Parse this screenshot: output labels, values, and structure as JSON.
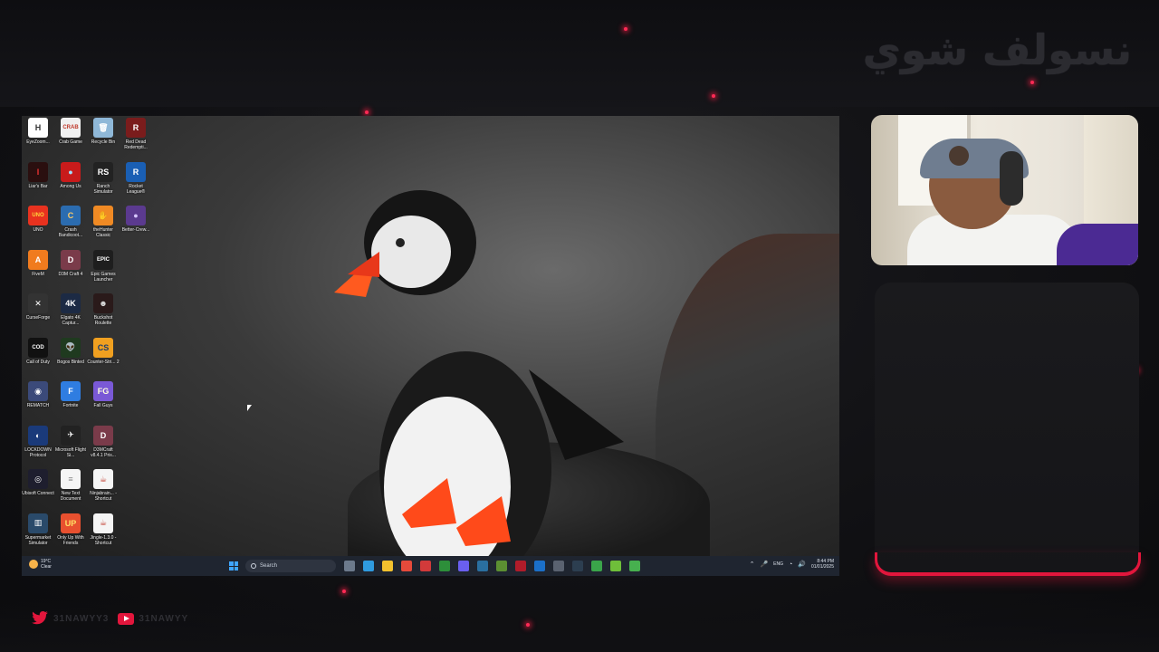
{
  "overlay": {
    "title": "نسولف شوي",
    "accent_color": "#e2163c"
  },
  "desktop": {
    "icons": [
      {
        "label": "EyeZoom...",
        "color": "#ffffff",
        "glyph": "H",
        "glyph_color": "#333"
      },
      {
        "label": "Crab Game",
        "color": "#f0f0f0",
        "glyph": "CRAB",
        "glyph_color": "#c0392b"
      },
      {
        "label": "Recycle Bin",
        "color": "#8fb8d8",
        "glyph": "🗑",
        "glyph_color": "#fff"
      },
      {
        "label": "Red Dead Redempti...",
        "color": "#7a1c1c",
        "glyph": "R",
        "glyph_color": "#fff"
      },
      {
        "label": "Liar's Bar",
        "color": "#2a0f0f",
        "glyph": "I",
        "glyph_color": "#e33"
      },
      {
        "label": "Among Us",
        "color": "#c81b1b",
        "glyph": "●",
        "glyph_color": "#9fe0ff"
      },
      {
        "label": "Ranch Simulator",
        "color": "#222",
        "glyph": "RS",
        "glyph_color": "#fff"
      },
      {
        "label": "Rocket League®",
        "color": "#1a5fb4",
        "glyph": "R",
        "glyph_color": "#fff"
      },
      {
        "label": "UNO",
        "color": "#e8321f",
        "glyph": "UNO",
        "glyph_color": "#ffd43b"
      },
      {
        "label": "Crash Bandicoot...",
        "color": "#2b6cb0",
        "glyph": "C",
        "glyph_color": "#ffcc66"
      },
      {
        "label": "theHunter Classic",
        "color": "#f08a24",
        "glyph": "✋",
        "glyph_color": "#fff"
      },
      {
        "label": "Better-Crew...",
        "color": "#5b3a8f",
        "glyph": "●",
        "glyph_color": "#d7c6ff"
      },
      {
        "label": "FiveM",
        "color": "#f07b1e",
        "glyph": "A",
        "glyph_color": "#fff"
      },
      {
        "label": "D3M Craft 4",
        "color": "#7a3b4a",
        "glyph": "D",
        "glyph_color": "#fff"
      },
      {
        "label": "Epic Games Launcher",
        "color": "#1e1e1e",
        "glyph": "EPIC",
        "glyph_color": "#fff"
      },
      {
        "label": "CurseForge",
        "color": "#333",
        "glyph": "✕",
        "glyph_color": "#fff"
      },
      {
        "label": "Elgato 4K Captur...",
        "color": "#1c2a44",
        "glyph": "4K",
        "glyph_color": "#fff"
      },
      {
        "label": "Buckshot Roulette",
        "color": "#2a1a1a",
        "glyph": "☻",
        "glyph_color": "#ddd"
      },
      {
        "label": "Call of Duty",
        "color": "#111",
        "glyph": "COD",
        "glyph_color": "#fff"
      },
      {
        "label": "Bogos Binted",
        "color": "#1f3a1f",
        "glyph": "👽",
        "glyph_color": "#7f7"
      },
      {
        "label": "Counter-Stri... 2",
        "color": "#f0a020",
        "glyph": "CS",
        "glyph_color": "#1c3c6c"
      },
      {
        "label": "REMATCH",
        "color": "#3b4a7a",
        "glyph": "◉",
        "glyph_color": "#fff"
      },
      {
        "label": "Fortnite",
        "color": "#2f7de1",
        "glyph": "F",
        "glyph_color": "#fff"
      },
      {
        "label": "Fall Guys",
        "color": "#7a59d6",
        "glyph": "FG",
        "glyph_color": "#ffd"
      },
      {
        "label": "LOCKDOWN Protocol",
        "color": "#1a3a7a",
        "glyph": "◐",
        "glyph_color": "#fff"
      },
      {
        "label": "Microsoft Flight Si...",
        "color": "#222",
        "glyph": "✈",
        "glyph_color": "#fff"
      },
      {
        "label": "D3MCraft v8.4.1 Pris...",
        "color": "#7a3b4a",
        "glyph": "D",
        "glyph_color": "#fff"
      },
      {
        "label": "Ubisoft Connect",
        "color": "#1e1e2e",
        "glyph": "◎",
        "glyph_color": "#fff"
      },
      {
        "label": "New Text Document",
        "color": "#f5f5f5",
        "glyph": "≡",
        "glyph_color": "#888"
      },
      {
        "label": "Ninjabrain... - Shortcut",
        "color": "#f5f5f5",
        "glyph": "☕",
        "glyph_color": "#c0392b"
      },
      {
        "label": "Supermarket Simulator",
        "color": "#2a4a6a",
        "glyph": "▥",
        "glyph_color": "#fff"
      },
      {
        "label": "Only Up With Friends",
        "color": "#e8502f",
        "glyph": "UP",
        "glyph_color": "#ffe066"
      },
      {
        "label": "Jingle-1.3.0 - Shortcut",
        "color": "#f5f5f5",
        "glyph": "☕",
        "glyph_color": "#c0392b"
      }
    ],
    "wallpaper_subject": "puffin"
  },
  "taskbar": {
    "weather_temp": "19°C",
    "weather_cond": "Clear",
    "search_placeholder": "Search",
    "apps": [
      {
        "name": "task-view-icon",
        "color": "#6c7a8c"
      },
      {
        "name": "edge-icon",
        "color": "#2f9be0"
      },
      {
        "name": "file-explorer-icon",
        "color": "#f2c12e"
      },
      {
        "name": "chrome-icon",
        "color": "#e64a3b"
      },
      {
        "name": "app-icon-red",
        "color": "#d23a3a"
      },
      {
        "name": "xbox-icon",
        "color": "#2d8f3a"
      },
      {
        "name": "discord-icon",
        "color": "#6a5ff0"
      },
      {
        "name": "steam-icon",
        "color": "#2a6fa0"
      },
      {
        "name": "minecraft-icon",
        "color": "#5c8f32"
      },
      {
        "name": "app-icon-dark-red",
        "color": "#b01c2a"
      },
      {
        "name": "outlook-icon",
        "color": "#1b6fc8"
      },
      {
        "name": "app-icon-gray",
        "color": "#5a6270"
      },
      {
        "name": "elgato-icon",
        "color": "#2c3e50"
      },
      {
        "name": "app-icon-green",
        "color": "#3aa54a"
      },
      {
        "name": "app-icon-lime",
        "color": "#6fbf3a"
      },
      {
        "name": "app-icon-green-2",
        "color": "#47b04f"
      }
    ],
    "tray_lang": "ENG",
    "clock_time": "8:44 PM",
    "clock_date": "01/01/2025"
  },
  "socials": {
    "twitter_handle": "31NAWYY3",
    "youtube_handle": "31NAWYY"
  }
}
